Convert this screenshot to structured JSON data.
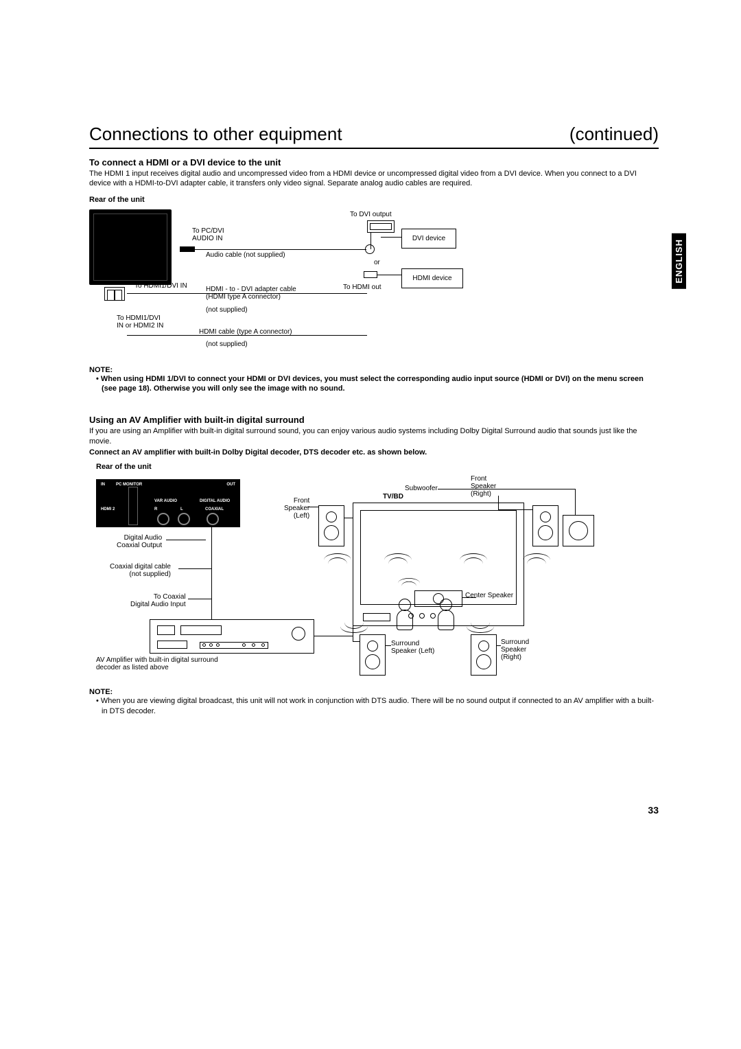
{
  "header": {
    "title_left": "Connections to other equipment",
    "title_right": "(continued)"
  },
  "lang_tab": "ENGLISH",
  "page_number": "33",
  "section1": {
    "heading": "To connect a HDMI or a DVI device to the unit",
    "body": "The HDMI 1 input receives digital audio and uncompressed video from a HDMI device or uncompressed digital video from a DVI device. When you connect to a DVI device with a HDMI-to-DVI adapter cable, it transfers only video signal. Separate analog audio cables are required.",
    "rear_label": "Rear of the unit",
    "labels": {
      "to_pcdvi_audio_in": "To PC/DVI\nAUDIO IN",
      "audio_cable": "Audio cable (not supplied)",
      "to_hdmi1_dvi_in": "To HDMI1/DVI IN",
      "hdmi_dvi_adapter": "HDMI - to - DVI adapter cable\n(HDMI type A connector)",
      "not_supplied_1": "(not supplied)",
      "to_hdmi1_or_2": "To HDMI1/DVI\nIN or HDMI2 IN",
      "hdmi_cable": "HDMI cable (type A connector)",
      "not_supplied_2": "(not supplied)",
      "to_dvi_output": "To DVI output",
      "or": "or",
      "to_hdmi_out": "To HDMI out",
      "dvi_device": "DVI device",
      "hdmi_device": "HDMI device"
    },
    "note_label": "NOTE:",
    "note_text": "• When using HDMI 1/DVI to connect your HDMI or DVI devices, you must select the corresponding audio input source (HDMI or DVI) on the menu screen (see page 18). Otherwise you will only see the image with no sound."
  },
  "section2": {
    "heading": "Using an AV Amplifier with built-in digital surround",
    "body": "If you are using an Amplifier with built-in digital surround sound, you can enjoy various audio systems including Dolby Digital Surround audio that sounds just like the movie.",
    "bold_line": "Connect an AV amplifier with built-in Dolby Digital decoder, DTS decoder etc. as shown below.",
    "rear_label": "Rear of the unit",
    "labels": {
      "digital_audio_coax_out": "Digital Audio\nCoaxial Output",
      "coax_cable": "Coaxial digital cable\n(not supplied)",
      "to_coax_input": "To Coaxial\nDigital Audio Input",
      "av_amp": "AV Amplifier with built-in digital surround\ndecoder as listed above",
      "front_left": "Front\nSpeaker\n(Left)",
      "front_right": "Front\nSpeaker\n(Right)",
      "subwoofer": "Subwoofer",
      "tvbd": "TV/BD",
      "center": "Center Speaker",
      "surround_left": "Surround\nSpeaker (Left)",
      "surround_right": "Surround\nSpeaker\n(Right)",
      "panel_in": "IN",
      "panel_pcmon": "PC MONITOR",
      "panel_out": "OUT",
      "panel_hdmi2": "HDMI 2",
      "panel_varaudio": "VAR AUDIO",
      "panel_r": "R",
      "panel_l": "L",
      "panel_digaudio": "DIGITAL AUDIO",
      "panel_coax": "COAXIAL"
    },
    "note_label": "NOTE:",
    "note_text": "• When you are viewing digital broadcast, this unit will not work in conjunction with DTS audio. There will be no sound output if connected to an AV amplifier with a built-in DTS decoder."
  }
}
